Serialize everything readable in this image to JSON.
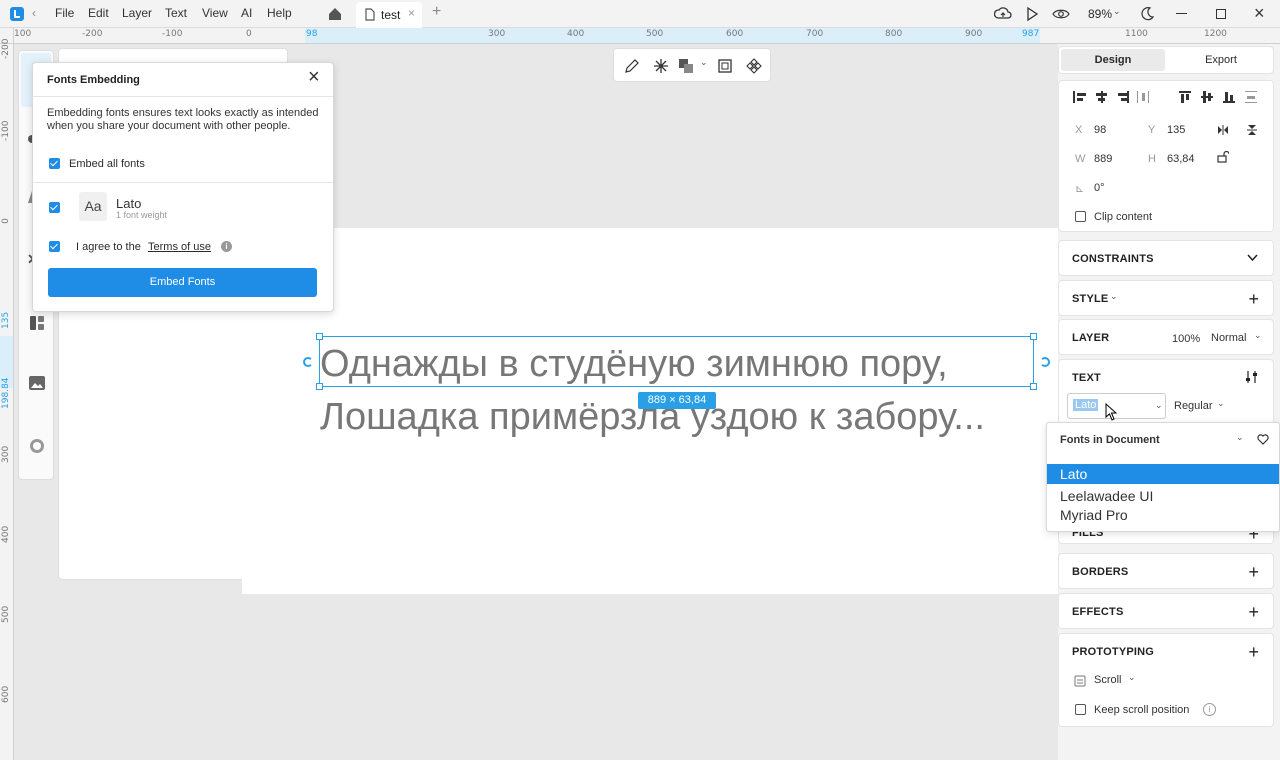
{
  "titlebar": {
    "menus": [
      "File",
      "Edit",
      "Layer",
      "Text",
      "View",
      "AI",
      "Help"
    ],
    "tab_name": "test",
    "zoom": "89%"
  },
  "rulers": {
    "h_ticks": [
      "100",
      "-200",
      "-100",
      "0",
      "98",
      "300",
      "400",
      "500",
      "600",
      "700",
      "800",
      "900",
      "987",
      "1100",
      "1200"
    ],
    "v_ticks": [
      "-200",
      "-100",
      "0",
      "135",
      "198.84",
      "300",
      "400",
      "500",
      "600"
    ]
  },
  "canvas": {
    "line1": "Однажды в студёную зимнюю пору,",
    "line2": "Лошадка примёрзла уздою к забору...",
    "size_badge": "889 × 63,84"
  },
  "dialog": {
    "title": "Fonts Embedding",
    "description": "Embedding fonts ensures text looks exactly as intended when you share your document with other people.",
    "embed_all_label": "Embed all fonts",
    "font_preview": "Aa",
    "font_name": "Lato",
    "font_weights": "1 font weight",
    "agree_prefix": "I agree to the",
    "terms_link": "Terms of use",
    "embed_button": "Embed Fonts"
  },
  "right_panel": {
    "tabs": {
      "design": "Design",
      "export": "Export"
    },
    "x_label": "X",
    "x_value": "98",
    "y_label": "Y",
    "y_value": "135",
    "w_label": "W",
    "w_value": "889",
    "h_label": "H",
    "h_value": "63,84",
    "rotation": "0°",
    "clip_content": "Clip content",
    "constraints": "CONSTRAINTS",
    "style": "STYLE",
    "layer": "LAYER",
    "layer_opacity": "100%",
    "layer_blend": "Normal",
    "text": "TEXT",
    "font_family": "Lato",
    "font_style": "Regular",
    "fills": "FILLS",
    "borders": "BORDERS",
    "effects": "EFFECTS",
    "prototyping": "PROTOTYPING",
    "scroll": "Scroll",
    "keep_scroll": "Keep scroll position"
  },
  "font_dropdown": {
    "header": "Fonts in Document",
    "items": [
      "Lato",
      "Leelawadee UI",
      "Myriad Pro"
    ]
  },
  "colors": {
    "accent": "#1f8ce6",
    "selection": "#29a0e6"
  }
}
